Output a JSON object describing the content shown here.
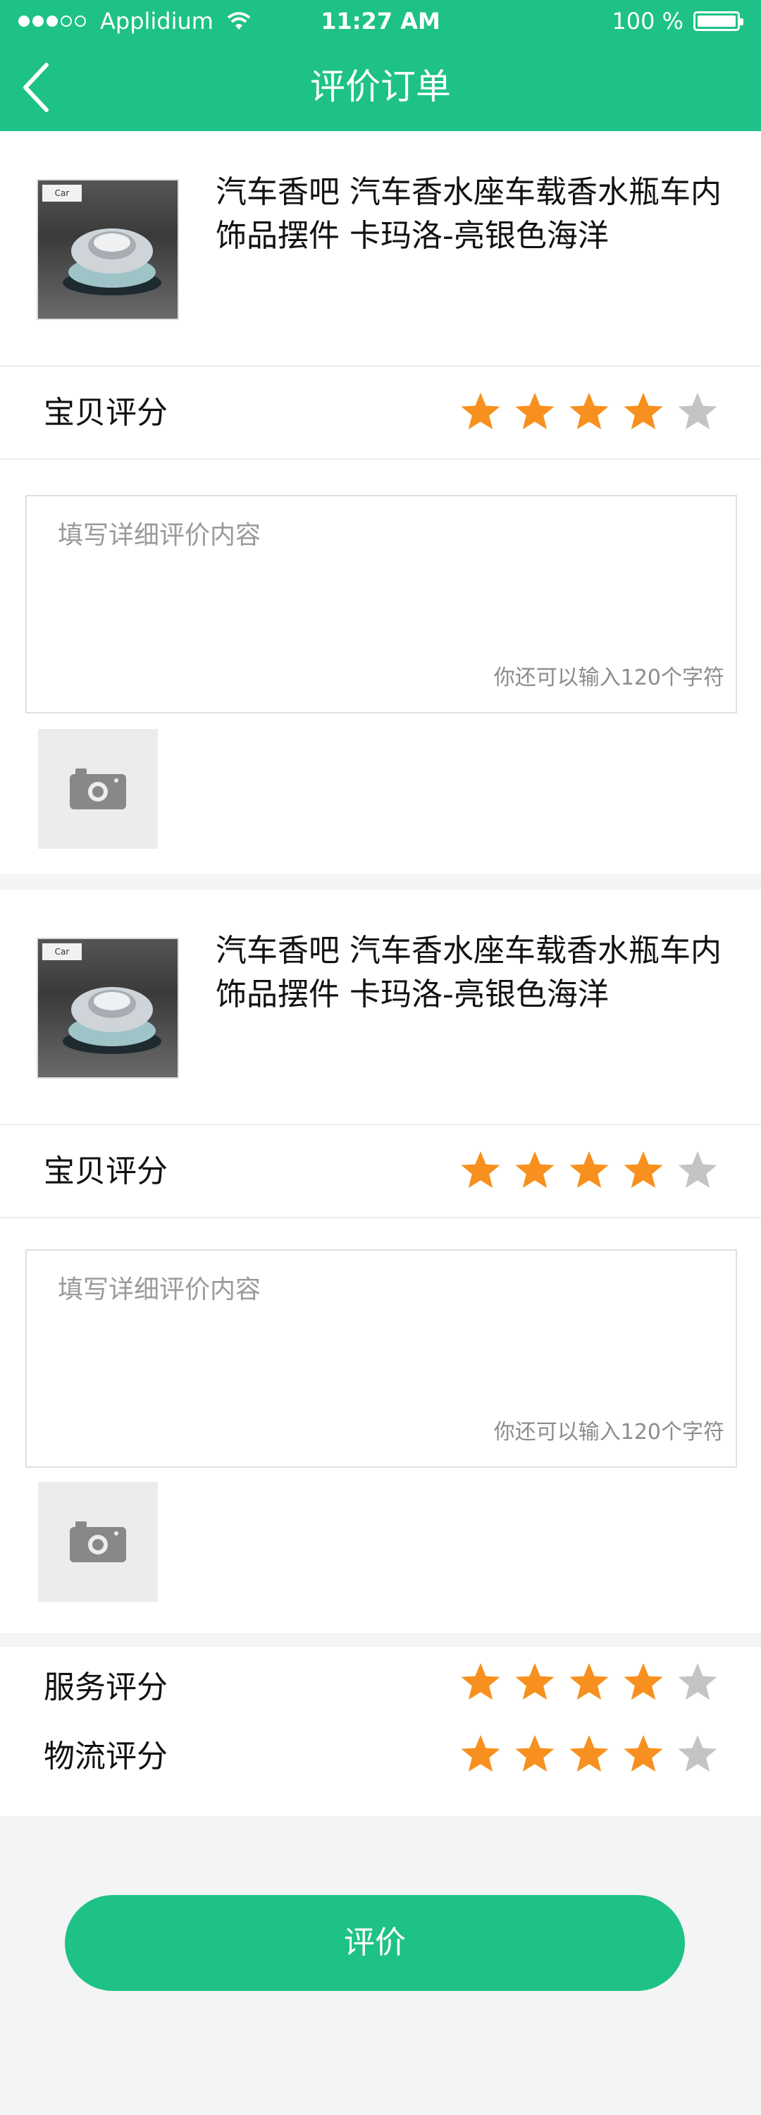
{
  "status_bar": {
    "carrier": "Applidium",
    "time": "11:27 AM",
    "battery": "100 %"
  },
  "nav": {
    "title": "评价订单",
    "back_icon": "chevron-left-icon"
  },
  "products": [
    {
      "title": "汽车香吧 汽车香水座车载香水瓶车内饰品摆件 卡玛洛-亮银色海洋",
      "rating_label": "宝贝评分",
      "rating": 4,
      "max_rating": 5,
      "review_placeholder": "填写详细评价内容",
      "char_counter": "你还可以输入120个字符",
      "photo_icon": "camera-icon"
    },
    {
      "title": "汽车香吧 汽车香水座车载香水瓶车内饰品摆件 卡玛洛-亮银色海洋",
      "rating_label": "宝贝评分",
      "rating": 4,
      "max_rating": 5,
      "review_placeholder": "填写详细评价内容",
      "char_counter": "你还可以输入120个字符",
      "photo_icon": "camera-icon"
    }
  ],
  "summary": {
    "service_label": "服务评分",
    "service_rating": 4,
    "logistics_label": "物流评分",
    "logistics_rating": 4
  },
  "submit_label": "评价",
  "colors": {
    "accent": "#1ec286",
    "star_active": "#f7901e",
    "star_inactive": "#c4c4c4"
  }
}
